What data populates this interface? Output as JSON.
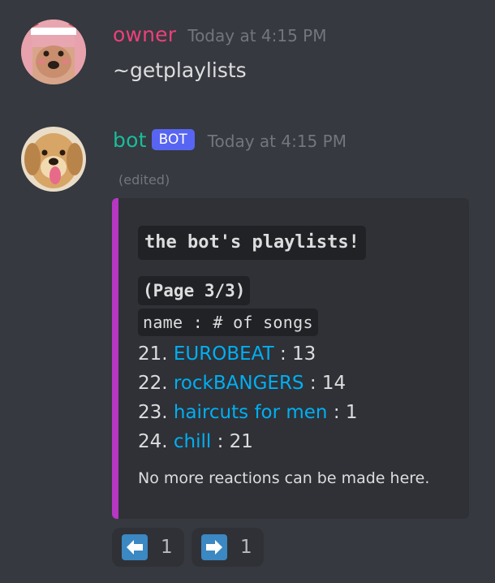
{
  "messages": [
    {
      "username": "owner",
      "username_color": "#ec407a",
      "timestamp": "Today at 4:15 PM",
      "content": "~getplaylists"
    },
    {
      "username": "bot",
      "username_color": "#1abc9c",
      "bot_tag": "BOT",
      "timestamp": "Today at 4:15 PM",
      "edited_label": "(edited)"
    }
  ],
  "embed": {
    "accent_color": "#b836c4",
    "title": "the bot's playlists!",
    "page_label": "(Page 3/3)",
    "column_header": "name : # of songs",
    "playlists": [
      {
        "index": "21.",
        "name": "EUROBEAT",
        "songs": "13"
      },
      {
        "index": "22.",
        "name": "rockBANGERS",
        "songs": "14"
      },
      {
        "index": "23.",
        "name": "haircuts for men",
        "songs": "1"
      },
      {
        "index": "24.",
        "name": "chill",
        "songs": "21"
      }
    ],
    "footer": "No more reactions can be made here."
  },
  "reactions": [
    {
      "icon": "left-arrow-icon",
      "count": "1"
    },
    {
      "icon": "right-arrow-icon",
      "count": "1"
    }
  ]
}
